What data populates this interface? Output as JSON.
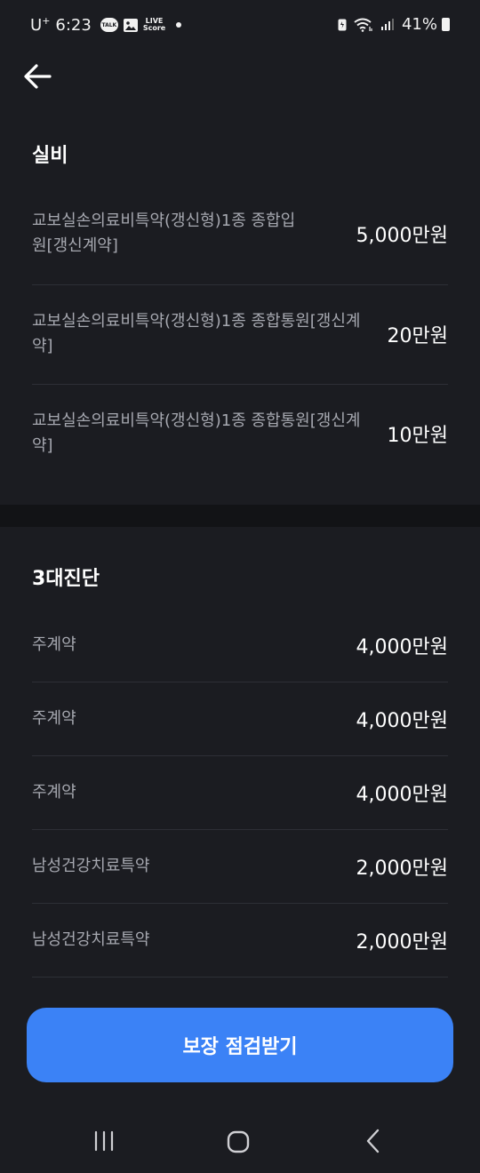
{
  "status_bar": {
    "carrier": "U",
    "carrier_sup": "+",
    "time": "6:23",
    "talk_badge": "TALK",
    "live_line1": "LIVE",
    "live_line2": "Score",
    "battery": "41%",
    "icons": [
      "talk-icon",
      "gallery-icon",
      "live-score-icon",
      "notification-dot-icon",
      "battery-saver-icon",
      "wifi-icon",
      "signal-icon",
      "battery-icon"
    ]
  },
  "sections": [
    {
      "title": "실비",
      "items": [
        {
          "label": "교보실손의료비특약(갱신형)1종 종합입원[갱신계약]",
          "amount": "5,000만원"
        },
        {
          "label": "교보실손의료비특약(갱신형)1종 종합통원[갱신계약]",
          "amount": "20만원"
        },
        {
          "label": "교보실손의료비특약(갱신형)1종 종합통원[갱신계약]",
          "amount": "10만원"
        }
      ]
    },
    {
      "title": "3대진단",
      "items": [
        {
          "label": "주계약",
          "amount": "4,000만원"
        },
        {
          "label": "주계약",
          "amount": "4,000만원"
        },
        {
          "label": "주계약",
          "amount": "4,000만원"
        },
        {
          "label": "남성건강치료특약",
          "amount": "2,000만원"
        },
        {
          "label": "남성건강치료특약",
          "amount": "2,000만원"
        }
      ]
    }
  ],
  "cta": {
    "label": "보장 점검받기"
  },
  "colors": {
    "background": "#1b1c21",
    "accent": "#3b82f6",
    "label": "#a6a8b0"
  }
}
